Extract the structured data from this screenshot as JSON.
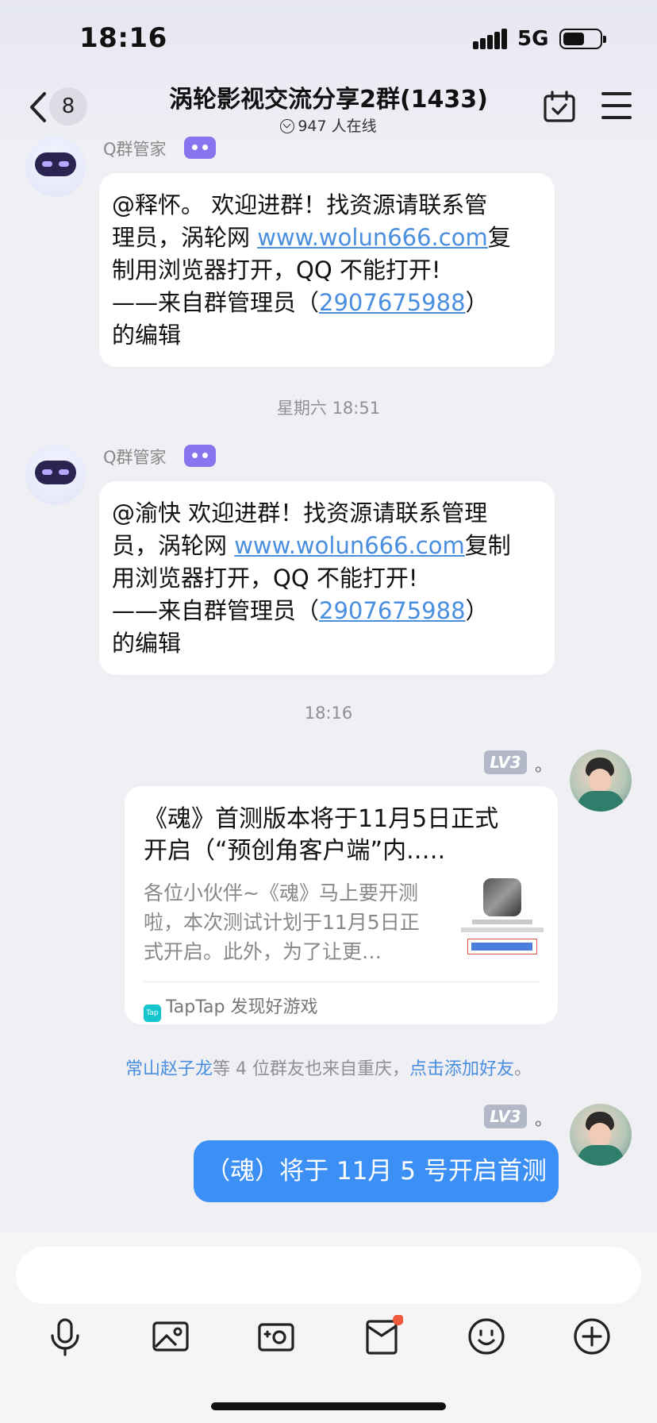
{
  "status_bar": {
    "time": "18:16",
    "network": "5G"
  },
  "nav": {
    "back_count": "8",
    "title": "涡轮影视交流分享2群(1433)",
    "online": "947 人在线"
  },
  "messages": [
    {
      "sender": "Q群管家",
      "lines": [
        {
          "pre": "@释怀。 欢迎进群！找资源请联系管"
        },
        {
          "pre": "理员，涡轮网 ",
          "link": "www.wolun666.com",
          "post": "复"
        },
        {
          "pre": "制用浏览器打开，QQ 不能打开!"
        },
        {
          "pre": "——来自群管理员（",
          "link": "2907675988",
          "post": "）"
        },
        {
          "pre": "的编辑"
        }
      ]
    },
    {
      "sender": "Q群管家",
      "lines": [
        {
          "pre": "@渝快 欢迎进群！找资源请联系管理"
        },
        {
          "pre": "员，涡轮网 ",
          "link": "www.wolun666.com",
          "post": "复制"
        },
        {
          "pre": "用浏览器打开，QQ 不能打开!"
        },
        {
          "pre": "——来自群管理员（",
          "link": "2907675988",
          "post": "）"
        },
        {
          "pre": "的编辑"
        }
      ]
    }
  ],
  "timestamps": {
    "t1": "星期六 18:51",
    "t2": "18:16"
  },
  "me": {
    "level": "LV3",
    "name": "。"
  },
  "card": {
    "title_lines": [
      "《魂》首测版本将于11月5日正式",
      "开启（“预创角客户端”内.…."
    ],
    "desc_lines": [
      "各位小伙伴~《魂》马上要开测",
      "啦，本次测试计划于11月5日正",
      "式开启。此外，为了让更…"
    ],
    "source_logo": "Tap",
    "source": "TapTap 发现好游戏"
  },
  "notice": {
    "name": "常山赵子龙",
    "middle": "等 4 位群友也来自重庆，",
    "action": "点击添加好友",
    "end": "。"
  },
  "my_message": "（魂）将于 11月 5 号开启首测",
  "toolbar": [
    "mic-icon",
    "image-icon",
    "camera-icon",
    "red-envelope-icon",
    "emoji-icon",
    "plus-icon"
  ]
}
